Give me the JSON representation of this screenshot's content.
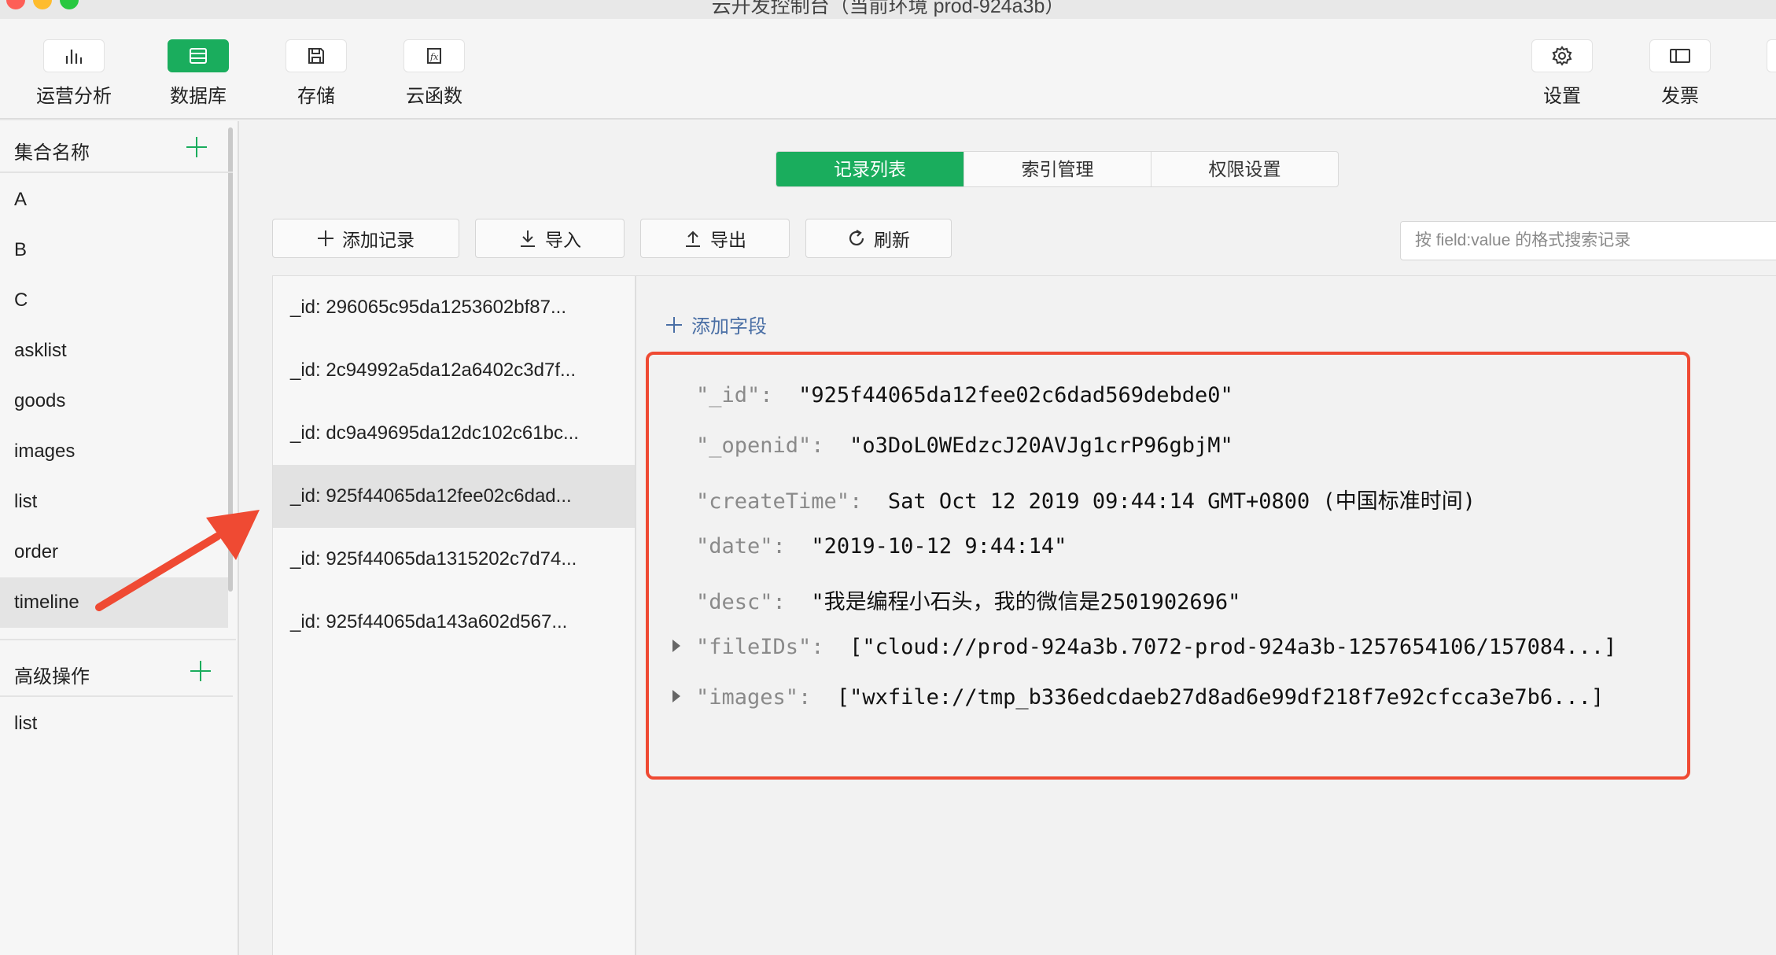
{
  "window": {
    "title": "云开发控制台（当前环境 prod-924a3b）",
    "traffic_colors": [
      "#fe5f57",
      "#febc2e",
      "#28c840"
    ]
  },
  "toolbar": {
    "left_items": [
      {
        "label": "运营分析",
        "icon": "bar-chart-icon",
        "active": false
      },
      {
        "label": "数据库",
        "icon": "database-icon",
        "active": true
      },
      {
        "label": "存储",
        "icon": "save-icon",
        "active": false
      },
      {
        "label": "云函数",
        "icon": "function-icon",
        "active": false
      }
    ],
    "right_items": [
      {
        "label": "设置",
        "icon": "gear-icon"
      },
      {
        "label": "发票",
        "icon": "invoice-icon"
      }
    ]
  },
  "sidebar": {
    "collections_title": "集合名称",
    "collections": [
      "A",
      "B",
      "C",
      "asklist",
      "goods",
      "images",
      "list",
      "order",
      "timeline"
    ],
    "selected_collection": "timeline",
    "advanced_title": "高级操作",
    "advanced_items": [
      "list"
    ]
  },
  "tabs": [
    "记录列表",
    "索引管理",
    "权限设置"
  ],
  "active_tab": "记录列表",
  "actions": {
    "add": "添加记录",
    "import": "导入",
    "export": "导出",
    "refresh": "刷新"
  },
  "search": {
    "placeholder": "按 field:value 的格式搜索记录",
    "value": ""
  },
  "records": [
    "_id: 296065c95da1253602bf87...",
    "_id: 2c94992a5da12a6402c3d7f...",
    "_id: dc9a49695da12dc102c61bc...",
    "_id: 925f44065da12fee02c6dad...",
    "_id: 925f44065da1315202c7d74...",
    "_id: 925f44065da143a602d567..."
  ],
  "selected_record_index": 3,
  "detail": {
    "add_field": "添加字段",
    "fields": [
      {
        "key": "\"_id\":",
        "value": "\"925f44065da12fee02c6dad569debde0\"",
        "expandable": false
      },
      {
        "key": "\"_openid\":",
        "value": "\"o3DoL0WEdzcJ20AVJg1crP96gbjM\"",
        "expandable": false
      },
      {
        "key": "\"createTime\":",
        "value": "Sat Oct 12 2019 09:44:14 GMT+0800 (中国标准时间)",
        "expandable": false
      },
      {
        "key": "\"date\":",
        "value": "\"2019-10-12 9:44:14\"",
        "expandable": false
      },
      {
        "key": "\"desc\":",
        "value": "\"我是编程小石头，我的微信是2501902696\"",
        "expandable": false
      },
      {
        "key": "\"fileIDs\":",
        "value": "[\"cloud://prod-924a3b.7072-prod-924a3b-1257654106/157084...]",
        "expandable": true
      },
      {
        "key": "\"images\":",
        "value": "[\"wxfile://tmp_b336edcdaeb27d8ad6e99df218f7e92cfcca3e7b6...]",
        "expandable": true
      }
    ]
  },
  "colors": {
    "accent": "#1aad5d",
    "highlight": "#ef4a33",
    "link": "#4a6fa5"
  }
}
